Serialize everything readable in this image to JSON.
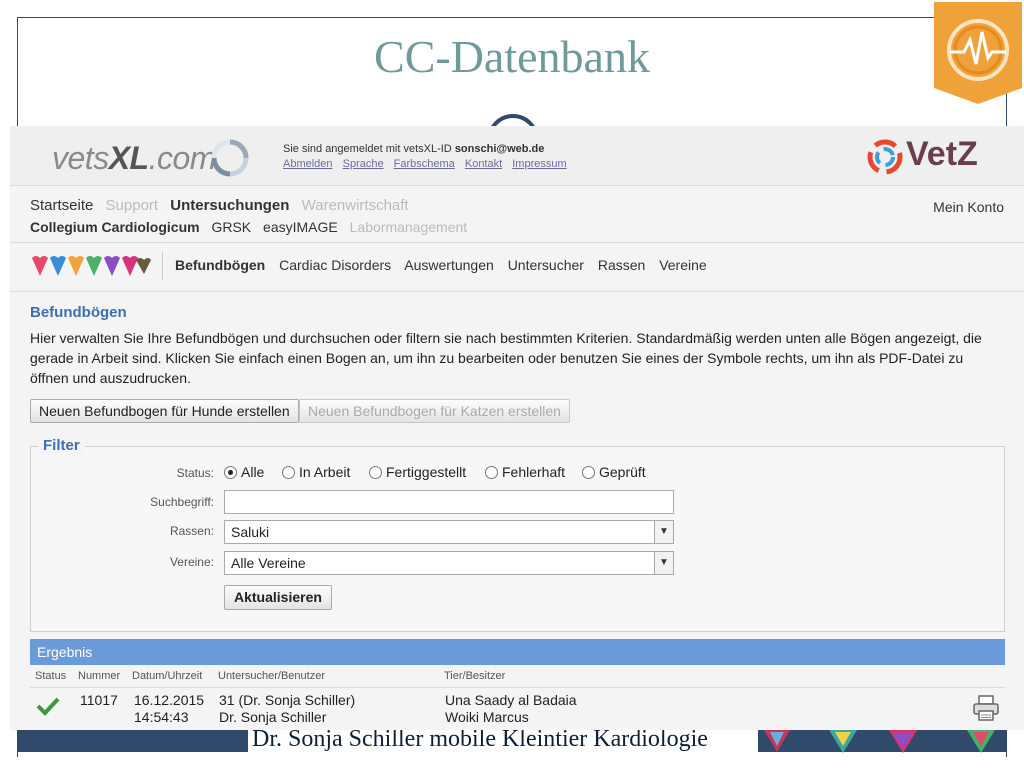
{
  "slide": {
    "title": "CC-Datenbank",
    "footer": "Dr. Sonja Schiller mobile Kleintier Kardiologie"
  },
  "header": {
    "logo_prefix": "vets",
    "logo_bold": "XL",
    "logo_suffix": ".com",
    "login_prefix": "Sie sind angemeldet mit vetsXL-ID",
    "login_user": "sonschi@web.de",
    "links": [
      "Abmelden",
      "Sprache",
      "Farbschema",
      "Kontakt",
      "Impressum"
    ],
    "brand_right": "VetZ"
  },
  "nav1": {
    "items": [
      {
        "label": "Startseite",
        "active": true
      },
      {
        "label": "Support",
        "active": false
      },
      {
        "label": "Untersuchungen",
        "active": true
      },
      {
        "label": "Warenwirtschaft",
        "active": false
      }
    ],
    "account": "Mein Konto"
  },
  "nav2": {
    "items": [
      {
        "label": "Collegium Cardiologicum",
        "active": true
      },
      {
        "label": "GRSK",
        "active": true
      },
      {
        "label": "easyIMAGE",
        "active": true
      },
      {
        "label": "Labormanagement",
        "active": false
      }
    ]
  },
  "nav3": {
    "items": [
      "Befundbögen",
      "Cardiac Disorders",
      "Auswertungen",
      "Untersucher",
      "Rassen",
      "Vereine"
    ]
  },
  "section": {
    "title": "Befundbögen",
    "description": "Hier verwalten Sie Ihre Befundbögen und durchsuchen oder filtern sie nach bestimmten Kriterien. Standardmäßig werden unten alle Bögen angezeigt, die gerade in Arbeit sind. Klicken Sie einfach einen Bogen an, um ihn zu bearbeiten oder benutzen Sie eines der Symbole rechts, um ihn als PDF-Datei zu öffnen und auszudrucken."
  },
  "buttons": {
    "new_dog": "Neuen Befundbogen für Hunde erstellen",
    "new_cat": "Neuen Befundbogen für Katzen erstellen"
  },
  "filter": {
    "legend": "Filter",
    "status_label": "Status:",
    "status_options": [
      "Alle",
      "In Arbeit",
      "Fertiggestellt",
      "Fehlerhaft",
      "Geprüft"
    ],
    "status_selected": "Alle",
    "search_label": "Suchbegriff:",
    "search_value": "",
    "breed_label": "Rassen:",
    "breed_value": "Saluki",
    "club_label": "Vereine:",
    "club_value": "Alle Vereine",
    "update_button": "Aktualisieren"
  },
  "results": {
    "title": "Ergebnis",
    "columns": [
      "Status",
      "Nummer",
      "Datum/Uhrzeit",
      "Untersucher/Benutzer",
      "Tier/Besitzer"
    ],
    "rows": [
      {
        "status_icon": "check-icon",
        "nummer": "11017",
        "datum": "16.12.2015",
        "uhrzeit": "14:54:43",
        "untersucher": "31 (Dr. Sonja Schiller)",
        "benutzer": "Dr. Sonja Schiller",
        "tier": "Una Saady al Badaia",
        "besitzer": "Woiki Marcus",
        "action_icon": "printer-icon"
      }
    ]
  },
  "colors": {
    "accent_blue": "#3e6fae",
    "result_bar": "#6a9bd8",
    "slide_navy": "#2f4a6a",
    "slide_title": "#6e9a9a",
    "badge_orange": "#f0a23a"
  }
}
